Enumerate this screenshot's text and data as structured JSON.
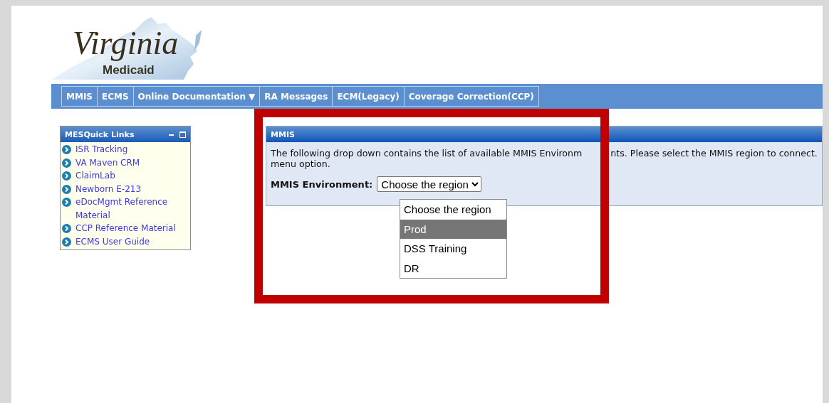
{
  "logo": {
    "title": "Virginia",
    "subtitle": "Medicaid"
  },
  "nav": [
    {
      "label": "MMIS"
    },
    {
      "label": "ECMS"
    },
    {
      "label": "Online Documentation ▼"
    },
    {
      "label": "RA Messages"
    },
    {
      "label": "ECM(Legacy)"
    },
    {
      "label": "Coverage Correction(CCP)"
    }
  ],
  "quick_links": {
    "title": "MESQuick Links",
    "links": [
      "ISR Tracking",
      "VA Maven CRM",
      "ClaimLab",
      "Newborn E-213",
      "eDocMgmt Reference Material",
      "CCP Reference Material",
      "ECMS User Guide"
    ]
  },
  "mmis_panel": {
    "title": "MMIS",
    "description_parts": [
      "The following drop down contains the list of available MMIS Environm",
      "nts. Please select the MMIS region to connect."
    ],
    "description_line_2": "menu option.",
    "field_label": "MMIS Environment:",
    "select_value": "Choose the region",
    "options": [
      {
        "label": "Choose the region",
        "selected": false
      },
      {
        "label": "Prod",
        "selected": true
      },
      {
        "label": "DSS Training",
        "selected": false
      },
      {
        "label": "DR",
        "selected": false
      }
    ]
  }
}
